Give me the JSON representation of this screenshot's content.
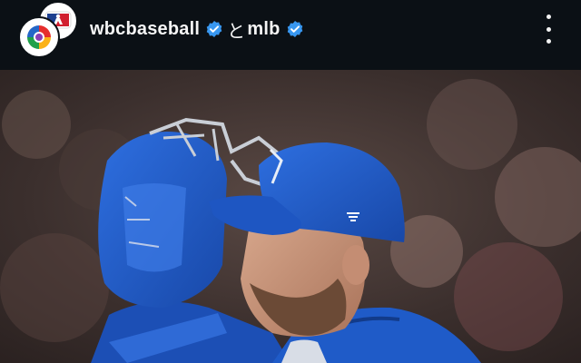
{
  "post": {
    "owner_primary": "wbcbaseball",
    "separator": "と",
    "owner_secondary": "mlb",
    "verified": true
  },
  "icons": {
    "more": "more-vertical-icon",
    "verified": "verified-badge-icon"
  },
  "colors": {
    "header_bg": "#0b1015",
    "verified_blue": "#3897f0",
    "jersey_blue": "#1f5bc8"
  }
}
